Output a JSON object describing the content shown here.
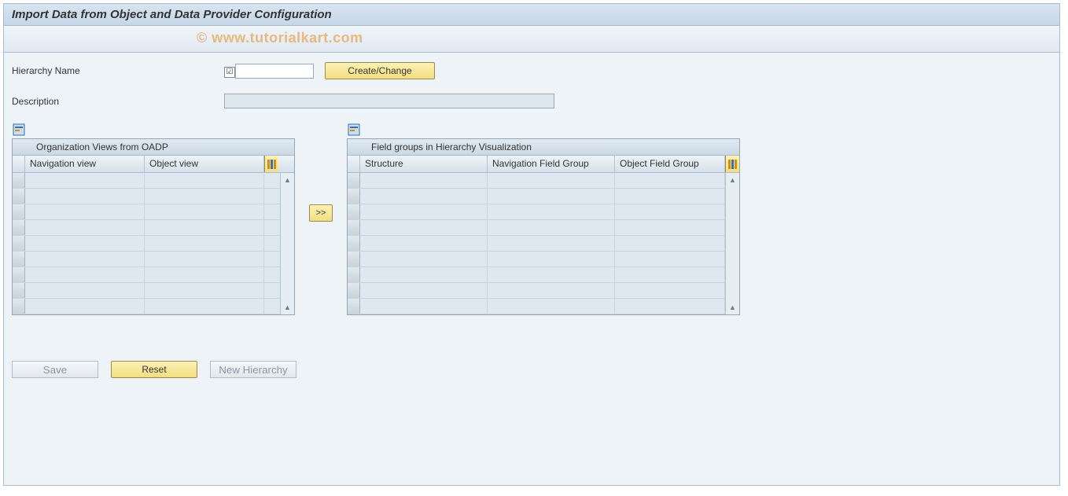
{
  "window": {
    "title": "Import Data from Object and Data Provider Configuration"
  },
  "form": {
    "hierarchy_label": "Hierarchy Name",
    "hierarchy_value": "",
    "create_change_label": "Create/Change",
    "description_label": "Description",
    "description_value": ""
  },
  "left_panel": {
    "title": "Organization Views from OADP",
    "columns": {
      "c1": "Navigation view",
      "c2": "Object view"
    },
    "rows": [
      "",
      "",
      "",
      "",
      "",
      "",
      "",
      "",
      ""
    ]
  },
  "transfer": {
    "label": ">>"
  },
  "right_panel": {
    "title": "Field groups in Hierarchy Visualization",
    "columns": {
      "c1": "Structure",
      "c2": "Navigation Field Group",
      "c3": "Object Field Group"
    },
    "rows": [
      "",
      "",
      "",
      "",
      "",
      "",
      "",
      "",
      ""
    ]
  },
  "footer": {
    "save": "Save",
    "reset": "Reset",
    "new_hierarchy": "New Hierarchy"
  },
  "watermark": "© www.tutorialkart.com"
}
